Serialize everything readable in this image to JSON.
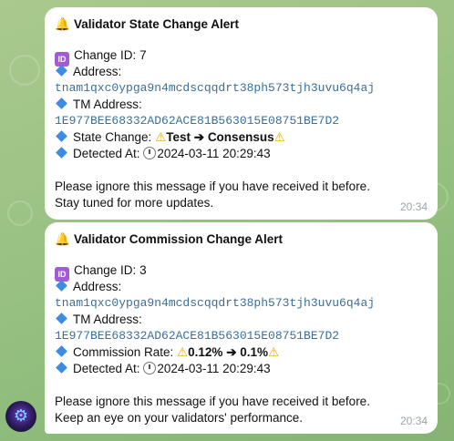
{
  "messages": [
    {
      "title": "Validator State Change Alert",
      "change_id_label": "Change ID:",
      "change_id": "7",
      "address_label": "Address:",
      "address": "tnam1qxc0ypga9n4mcdscqqdrt38ph573tjh3uvu6q4aj",
      "tm_address_label": "TM Address:",
      "tm_address": "1E977BEE68332AD62ACE81B563015E08751BE7D2",
      "change_label": "State Change:",
      "change_from": "Test",
      "change_arrow": "➔",
      "change_to": "Consensus",
      "detected_label": "Detected At:",
      "detected_at": "2024-03-11 20:29:43",
      "footer_1": "Please ignore this message if you have received it before.",
      "footer_2": "Stay tuned for more updates.",
      "time": "20:34"
    },
    {
      "title": "Validator Commission Change Alert",
      "change_id_label": "Change ID:",
      "change_id": "3",
      "address_label": "Address:",
      "address": "tnam1qxc0ypga9n4mcdscqqdrt38ph573tjh3uvu6q4aj",
      "tm_address_label": "TM Address:",
      "tm_address": "1E977BEE68332AD62ACE81B563015E08751BE7D2",
      "change_label": "Commission Rate:",
      "change_from": "0.12%",
      "change_arrow": "➔",
      "change_to": "0.1%",
      "detected_label": "Detected At:",
      "detected_at": "2024-03-11 20:29:43",
      "footer_1": "Please ignore this message if you have received it before.",
      "footer_2": "Keep an eye on your validators' performance.",
      "time": "20:34"
    }
  ],
  "icons": {
    "title": "bell-icon",
    "change_id": "id-icon",
    "bullet": "blue-diamond-icon",
    "warning": "warning-icon",
    "clock": "clock-icon"
  },
  "glyphs": {
    "bell": "🔔",
    "id": "ID",
    "warning": "⚠",
    "avatar": "⚙"
  },
  "colors": {
    "background": "#9dc386",
    "bubble": "#ffffff",
    "address_text": "#3a6f9b",
    "bullet": "#3d8ddf",
    "timestamp": "#9aa3ad"
  }
}
